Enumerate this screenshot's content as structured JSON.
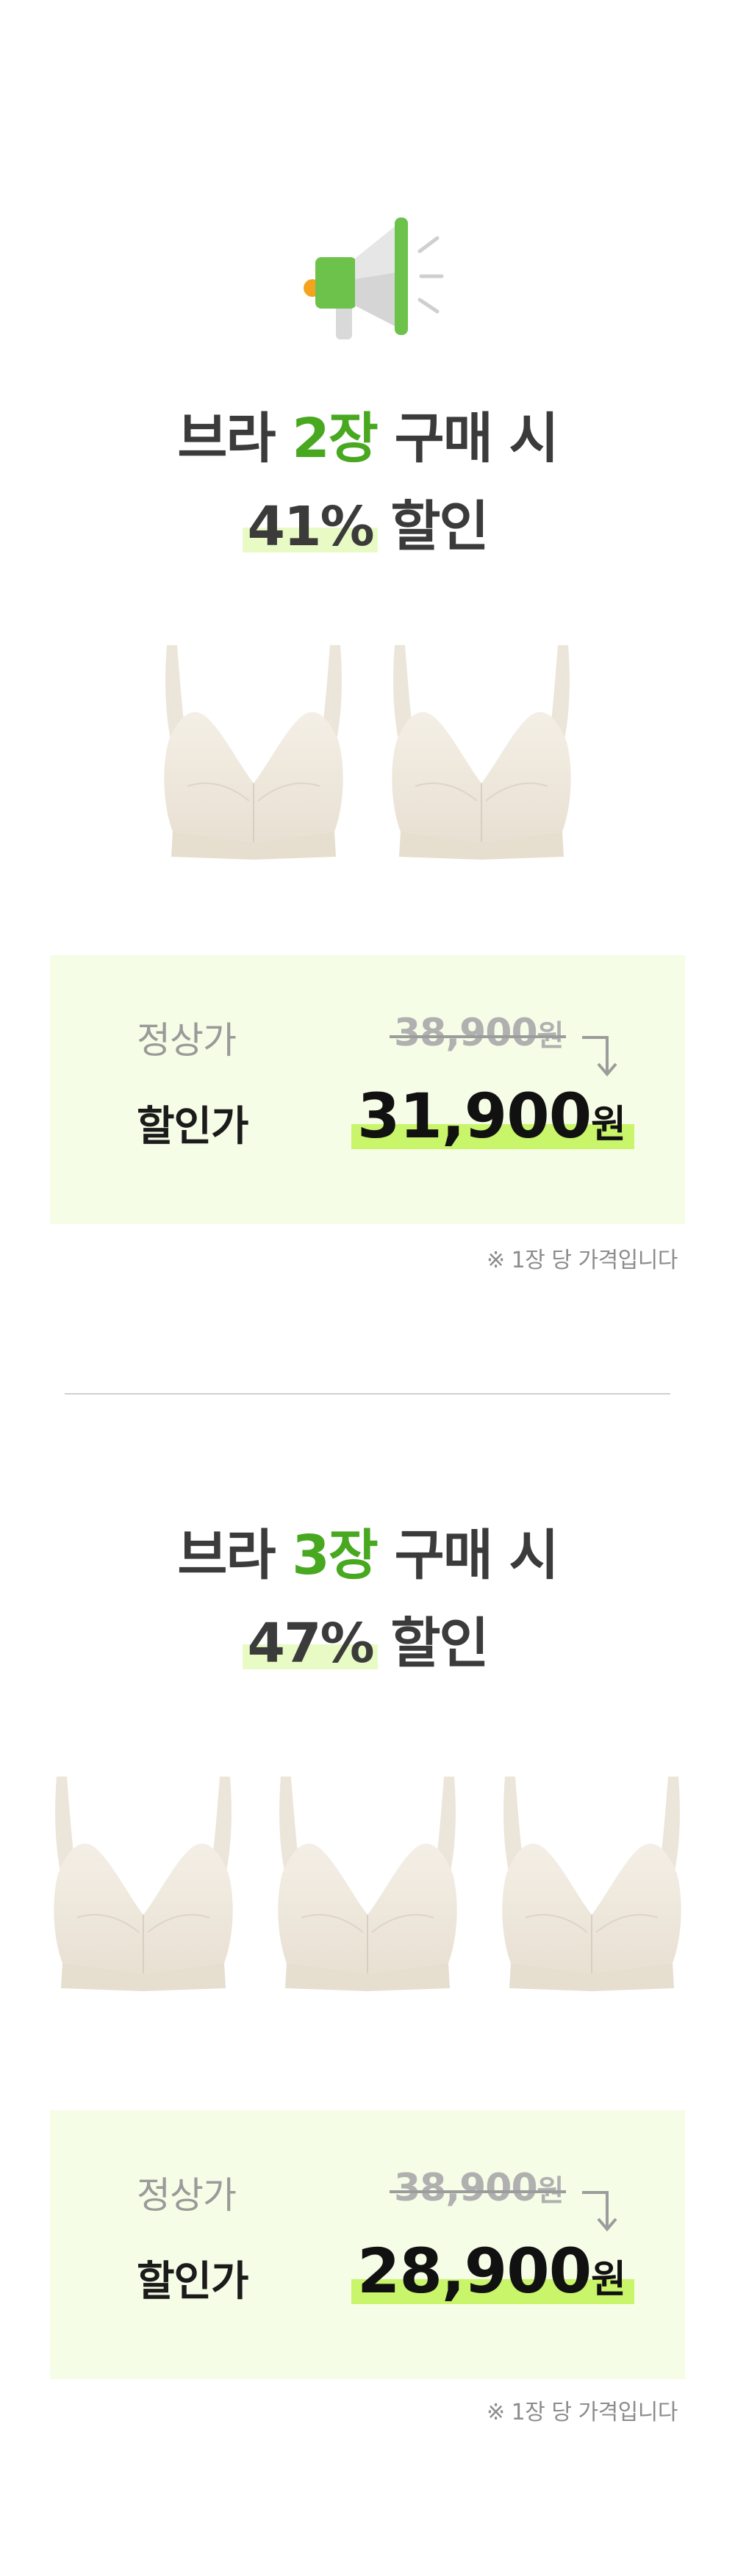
{
  "promo1": {
    "head_prefix": "브라 ",
    "head_count": "2장",
    "head_suffix": " 구매 시",
    "percent": "41%",
    "percent_suffix": " 할인",
    "regular_label": "정상가",
    "regular_price": "38,900",
    "regular_unit": "원",
    "sale_label": "할인가",
    "sale_price": "31,900",
    "sale_unit": "원",
    "note": "※ 1장 당 가격입니다"
  },
  "promo2": {
    "head_prefix": "브라 ",
    "head_count": "3장",
    "head_suffix": " 구매 시",
    "percent": "47%",
    "percent_suffix": " 할인",
    "regular_label": "정상가",
    "regular_price": "38,900",
    "regular_unit": "원",
    "sale_label": "할인가",
    "sale_price": "28,900",
    "sale_unit": "원",
    "note": "※ 1장 당 가격입니다"
  },
  "colors": {
    "accent_green": "#48a820",
    "box_bg": "#f6fde6",
    "highlight": "#c9f56a",
    "bra_color": "#efe8dc"
  },
  "icons": [
    "megaphone-icon",
    "down-arrow-icon"
  ]
}
